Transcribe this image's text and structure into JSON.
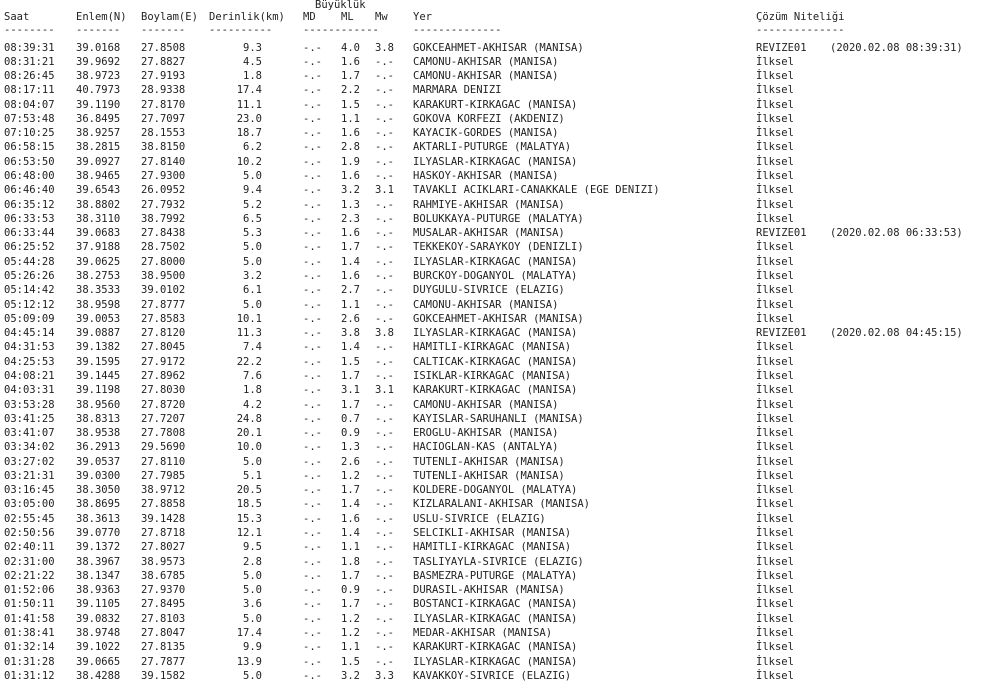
{
  "header": {
    "magnitude_group": "Büyüklük",
    "columns": {
      "time": "Saat",
      "lat": "Enlem(N)",
      "lon": "Boylam(E)",
      "depth": "Derinlik(km)",
      "md": "MD",
      "ml": "ML",
      "mw": "Mw",
      "location": "Yer",
      "solution": "Çözüm Niteliği"
    },
    "separators": {
      "time": "--------",
      "lat": "-------",
      "lon": "-------",
      "depth": "----------",
      "mag": "------------",
      "location": "--------------",
      "solution": "--------------"
    }
  },
  "rows": [
    {
      "time": "08:39:31",
      "lat": "39.0168",
      "lon": "27.8508",
      "depth": "9.3",
      "md": "-.-",
      "ml": "4.0",
      "mw": "3.8",
      "location": "GOKCEAHMET-AKHISAR (MANISA)",
      "solution": "REVIZE01",
      "revised": "(2020.02.08 08:39:31)"
    },
    {
      "time": "08:31:21",
      "lat": "39.9692",
      "lon": "27.8827",
      "depth": "4.5",
      "md": "-.-",
      "ml": "1.6",
      "mw": "-.-",
      "location": "CAMONU-AKHISAR (MANISA)",
      "solution": "İlksel",
      "revised": ""
    },
    {
      "time": "08:26:45",
      "lat": "38.9723",
      "lon": "27.9193",
      "depth": "1.8",
      "md": "-.-",
      "ml": "1.7",
      "mw": "-.-",
      "location": "CAMONU-AKHISAR (MANISA)",
      "solution": "İlksel",
      "revised": ""
    },
    {
      "time": "08:17:11",
      "lat": "40.7973",
      "lon": "28.9338",
      "depth": "17.4",
      "md": "-.-",
      "ml": "2.2",
      "mw": "-.-",
      "location": "MARMARA DENIZI",
      "solution": "İlksel",
      "revised": ""
    },
    {
      "time": "08:04:07",
      "lat": "39.1190",
      "lon": "27.8170",
      "depth": "11.1",
      "md": "-.-",
      "ml": "1.5",
      "mw": "-.-",
      "location": "KARAKURT-KIRKAGAC (MANISA)",
      "solution": "İlksel",
      "revised": ""
    },
    {
      "time": "07:53:48",
      "lat": "36.8495",
      "lon": "27.7097",
      "depth": "23.0",
      "md": "-.-",
      "ml": "1.1",
      "mw": "-.-",
      "location": "GOKOVA KORFEZI (AKDENIZ)",
      "solution": "İlksel",
      "revised": ""
    },
    {
      "time": "07:10:25",
      "lat": "38.9257",
      "lon": "28.1553",
      "depth": "18.7",
      "md": "-.-",
      "ml": "1.6",
      "mw": "-.-",
      "location": "KAYACIK-GORDES (MANISA)",
      "solution": "İlksel",
      "revised": ""
    },
    {
      "time": "06:58:15",
      "lat": "38.2815",
      "lon": "38.8150",
      "depth": "6.2",
      "md": "-.-",
      "ml": "2.8",
      "mw": "-.-",
      "location": "AKTARLI-PUTURGE (MALATYA)",
      "solution": "İlksel",
      "revised": ""
    },
    {
      "time": "06:53:50",
      "lat": "39.0927",
      "lon": "27.8140",
      "depth": "10.2",
      "md": "-.-",
      "ml": "1.9",
      "mw": "-.-",
      "location": "ILYASLAR-KIRKAGAC (MANISA)",
      "solution": "İlksel",
      "revised": ""
    },
    {
      "time": "06:48:00",
      "lat": "38.9465",
      "lon": "27.9300",
      "depth": "5.0",
      "md": "-.-",
      "ml": "1.6",
      "mw": "-.-",
      "location": "HASKOY-AKHISAR (MANISA)",
      "solution": "İlksel",
      "revised": ""
    },
    {
      "time": "06:46:40",
      "lat": "39.6543",
      "lon": "26.0952",
      "depth": "9.4",
      "md": "-.-",
      "ml": "3.2",
      "mw": "3.1",
      "location": "TAVAKLI ACIKLARI-CANAKKALE (EGE DENIZI)",
      "solution": "İlksel",
      "revised": ""
    },
    {
      "time": "06:35:12",
      "lat": "38.8802",
      "lon": "27.7932",
      "depth": "5.2",
      "md": "-.-",
      "ml": "1.3",
      "mw": "-.-",
      "location": "RAHMIYE-AKHISAR (MANISA)",
      "solution": "İlksel",
      "revised": ""
    },
    {
      "time": "06:33:53",
      "lat": "38.3110",
      "lon": "38.7992",
      "depth": "6.5",
      "md": "-.-",
      "ml": "2.3",
      "mw": "-.-",
      "location": "BOLUKKAYA-PUTURGE (MALATYA)",
      "solution": "İlksel",
      "revised": ""
    },
    {
      "time": "06:33:44",
      "lat": "39.0683",
      "lon": "27.8438",
      "depth": "5.3",
      "md": "-.-",
      "ml": "1.6",
      "mw": "-.-",
      "location": "MUSALAR-AKHISAR (MANISA)",
      "solution": "REVIZE01",
      "revised": "(2020.02.08 06:33:53)"
    },
    {
      "time": "06:25:52",
      "lat": "37.9188",
      "lon": "28.7502",
      "depth": "5.0",
      "md": "-.-",
      "ml": "1.7",
      "mw": "-.-",
      "location": "TEKKEKOY-SARAYKOY (DENIZLI)",
      "solution": "İlksel",
      "revised": ""
    },
    {
      "time": "05:44:28",
      "lat": "39.0625",
      "lon": "27.8000",
      "depth": "5.0",
      "md": "-.-",
      "ml": "1.4",
      "mw": "-.-",
      "location": "ILYASLAR-KIRKAGAC (MANISA)",
      "solution": "İlksel",
      "revised": ""
    },
    {
      "time": "05:26:26",
      "lat": "38.2753",
      "lon": "38.9500",
      "depth": "3.2",
      "md": "-.-",
      "ml": "1.6",
      "mw": "-.-",
      "location": "BURCKOY-DOGANYOL (MALATYA)",
      "solution": "İlksel",
      "revised": ""
    },
    {
      "time": "05:14:42",
      "lat": "38.3533",
      "lon": "39.0102",
      "depth": "6.1",
      "md": "-.-",
      "ml": "2.7",
      "mw": "-.-",
      "location": "DUYGULU-SIVRICE (ELAZIG)",
      "solution": "İlksel",
      "revised": ""
    },
    {
      "time": "05:12:12",
      "lat": "38.9598",
      "lon": "27.8777",
      "depth": "5.0",
      "md": "-.-",
      "ml": "1.1",
      "mw": "-.-",
      "location": "CAMONU-AKHISAR (MANISA)",
      "solution": "İlksel",
      "revised": ""
    },
    {
      "time": "05:09:09",
      "lat": "39.0053",
      "lon": "27.8583",
      "depth": "10.1",
      "md": "-.-",
      "ml": "2.6",
      "mw": "-.-",
      "location": "GOKCEAHMET-AKHISAR (MANISA)",
      "solution": "İlksel",
      "revised": ""
    },
    {
      "time": "04:45:14",
      "lat": "39.0887",
      "lon": "27.8120",
      "depth": "11.3",
      "md": "-.-",
      "ml": "3.8",
      "mw": "3.8",
      "location": "ILYASLAR-KIRKAGAC (MANISA)",
      "solution": "REVIZE01",
      "revised": "(2020.02.08 04:45:15)"
    },
    {
      "time": "04:31:53",
      "lat": "39.1382",
      "lon": "27.8045",
      "depth": "7.4",
      "md": "-.-",
      "ml": "1.4",
      "mw": "-.-",
      "location": "HAMITLI-KIRKAGAC (MANISA)",
      "solution": "İlksel",
      "revised": ""
    },
    {
      "time": "04:25:53",
      "lat": "39.1595",
      "lon": "27.9172",
      "depth": "22.2",
      "md": "-.-",
      "ml": "1.5",
      "mw": "-.-",
      "location": "CALTICAK-KIRKAGAC (MANISA)",
      "solution": "İlksel",
      "revised": ""
    },
    {
      "time": "04:08:21",
      "lat": "39.1445",
      "lon": "27.8962",
      "depth": "7.6",
      "md": "-.-",
      "ml": "1.7",
      "mw": "-.-",
      "location": "ISIKLAR-KIRKAGAC (MANISA)",
      "solution": "İlksel",
      "revised": ""
    },
    {
      "time": "04:03:31",
      "lat": "39.1198",
      "lon": "27.8030",
      "depth": "1.8",
      "md": "-.-",
      "ml": "3.1",
      "mw": "3.1",
      "location": "KARAKURT-KIRKAGAC (MANISA)",
      "solution": "İlksel",
      "revised": ""
    },
    {
      "time": "03:53:28",
      "lat": "38.9560",
      "lon": "27.8720",
      "depth": "4.2",
      "md": "-.-",
      "ml": "1.7",
      "mw": "-.-",
      "location": "CAMONU-AKHISAR (MANISA)",
      "solution": "İlksel",
      "revised": ""
    },
    {
      "time": "03:41:25",
      "lat": "38.8313",
      "lon": "27.7207",
      "depth": "24.8",
      "md": "-.-",
      "ml": "0.7",
      "mw": "-.-",
      "location": "KAYISLAR-SARUHANLI (MANISA)",
      "solution": "İlksel",
      "revised": ""
    },
    {
      "time": "03:41:07",
      "lat": "38.9538",
      "lon": "27.7808",
      "depth": "20.1",
      "md": "-.-",
      "ml": "0.9",
      "mw": "-.-",
      "location": "EROGLU-AKHISAR (MANISA)",
      "solution": "İlksel",
      "revised": ""
    },
    {
      "time": "03:34:02",
      "lat": "36.2913",
      "lon": "29.5690",
      "depth": "10.0",
      "md": "-.-",
      "ml": "1.3",
      "mw": "-.-",
      "location": "HACIOGLAN-KAS (ANTALYA)",
      "solution": "İlksel",
      "revised": ""
    },
    {
      "time": "03:27:02",
      "lat": "39.0537",
      "lon": "27.8110",
      "depth": "5.0",
      "md": "-.-",
      "ml": "2.6",
      "mw": "-.-",
      "location": "TUTENLI-AKHISAR (MANISA)",
      "solution": "İlksel",
      "revised": ""
    },
    {
      "time": "03:21:31",
      "lat": "39.0300",
      "lon": "27.7985",
      "depth": "5.1",
      "md": "-.-",
      "ml": "1.2",
      "mw": "-.-",
      "location": "TUTENLI-AKHISAR (MANISA)",
      "solution": "İlksel",
      "revised": ""
    },
    {
      "time": "03:16:45",
      "lat": "38.3050",
      "lon": "38.9712",
      "depth": "20.5",
      "md": "-.-",
      "ml": "1.7",
      "mw": "-.-",
      "location": "KOLDERE-DOGANYOL (MALATYA)",
      "solution": "İlksel",
      "revised": ""
    },
    {
      "time": "03:05:00",
      "lat": "38.8695",
      "lon": "27.8858",
      "depth": "18.5",
      "md": "-.-",
      "ml": "1.4",
      "mw": "-.-",
      "location": "KIZLARALANI-AKHISAR (MANISA)",
      "solution": "İlksel",
      "revised": ""
    },
    {
      "time": "02:55:45",
      "lat": "38.3613",
      "lon": "39.1428",
      "depth": "15.3",
      "md": "-.-",
      "ml": "1.6",
      "mw": "-.-",
      "location": "USLU-SIVRICE (ELAZIG)",
      "solution": "İlksel",
      "revised": ""
    },
    {
      "time": "02:50:56",
      "lat": "39.0770",
      "lon": "27.8718",
      "depth": "12.1",
      "md": "-.-",
      "ml": "1.4",
      "mw": "-.-",
      "location": "SELCIKLI-AKHISAR (MANISA)",
      "solution": "İlksel",
      "revised": ""
    },
    {
      "time": "02:40:11",
      "lat": "39.1372",
      "lon": "27.8027",
      "depth": "9.5",
      "md": "-.-",
      "ml": "1.1",
      "mw": "-.-",
      "location": "HAMITLI-KIRKAGAC (MANISA)",
      "solution": "İlksel",
      "revised": ""
    },
    {
      "time": "02:31:00",
      "lat": "38.3967",
      "lon": "38.9573",
      "depth": "2.8",
      "md": "-.-",
      "ml": "1.8",
      "mw": "-.-",
      "location": "TASLIYAYLA-SIVRICE (ELAZIG)",
      "solution": "İlksel",
      "revised": ""
    },
    {
      "time": "02:21:22",
      "lat": "38.1347",
      "lon": "38.6785",
      "depth": "5.0",
      "md": "-.-",
      "ml": "1.7",
      "mw": "-.-",
      "location": "BASMEZRA-PUTURGE (MALATYA)",
      "solution": "İlksel",
      "revised": ""
    },
    {
      "time": "01:52:06",
      "lat": "38.9363",
      "lon": "27.9370",
      "depth": "5.0",
      "md": "-.-",
      "ml": "0.9",
      "mw": "-.-",
      "location": "DURASIL-AKHISAR (MANISA)",
      "solution": "İlksel",
      "revised": ""
    },
    {
      "time": "01:50:11",
      "lat": "39.1105",
      "lon": "27.8495",
      "depth": "3.6",
      "md": "-.-",
      "ml": "1.7",
      "mw": "-.-",
      "location": "BOSTANCI-KIRKAGAC (MANISA)",
      "solution": "İlksel",
      "revised": ""
    },
    {
      "time": "01:41:58",
      "lat": "39.0832",
      "lon": "27.8103",
      "depth": "5.0",
      "md": "-.-",
      "ml": "1.2",
      "mw": "-.-",
      "location": "ILYASLAR-KIRKAGAC (MANISA)",
      "solution": "İlksel",
      "revised": ""
    },
    {
      "time": "01:38:41",
      "lat": "38.9748",
      "lon": "27.8047",
      "depth": "17.4",
      "md": "-.-",
      "ml": "1.2",
      "mw": "-.-",
      "location": "MEDAR-AKHISAR (MANISA)",
      "solution": "İlksel",
      "revised": ""
    },
    {
      "time": "01:32:14",
      "lat": "39.1022",
      "lon": "27.8135",
      "depth": "9.9",
      "md": "-.-",
      "ml": "1.1",
      "mw": "-.-",
      "location": "KARAKURT-KIRKAGAC (MANISA)",
      "solution": "İlksel",
      "revised": ""
    },
    {
      "time": "01:31:28",
      "lat": "39.0665",
      "lon": "27.7877",
      "depth": "13.9",
      "md": "-.-",
      "ml": "1.5",
      "mw": "-.-",
      "location": "ILYASLAR-KIRKAGAC (MANISA)",
      "solution": "İlksel",
      "revised": ""
    },
    {
      "time": "01:31:12",
      "lat": "38.4288",
      "lon": "39.1582",
      "depth": "5.0",
      "md": "-.-",
      "ml": "3.2",
      "mw": "3.3",
      "location": "KAVAKKOY-SIVRICE (ELAZIG)",
      "solution": "İlksel",
      "revised": ""
    }
  ]
}
